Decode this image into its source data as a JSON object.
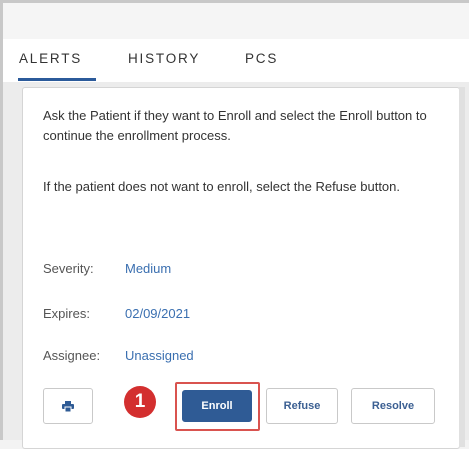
{
  "tabs": [
    {
      "label": "ALERTS",
      "active": true
    },
    {
      "label": "HISTORY",
      "active": false
    },
    {
      "label": "PCS",
      "active": false
    }
  ],
  "alert": {
    "message_1": "Ask the Patient if they want to Enroll and select the Enroll button to continue the enrollment process.",
    "message_2": "If the patient does not want to enroll, select the Refuse button.",
    "severity_label": "Severity:",
    "severity_value": "Medium",
    "expires_label": "Expires:",
    "expires_value": "02/09/2021",
    "assignee_label": "Assignee:",
    "assignee_value": "Unassigned"
  },
  "actions": {
    "print_icon": "print-icon",
    "enroll_label": "Enroll",
    "refuse_label": "Refuse",
    "resolve_label": "Resolve"
  },
  "annotation": {
    "step_number": "1",
    "highlight_color": "#d9534f",
    "badge_color": "#d32f2f"
  },
  "colors": {
    "accent": "#2f5b95",
    "link": "#3a6fb0"
  }
}
